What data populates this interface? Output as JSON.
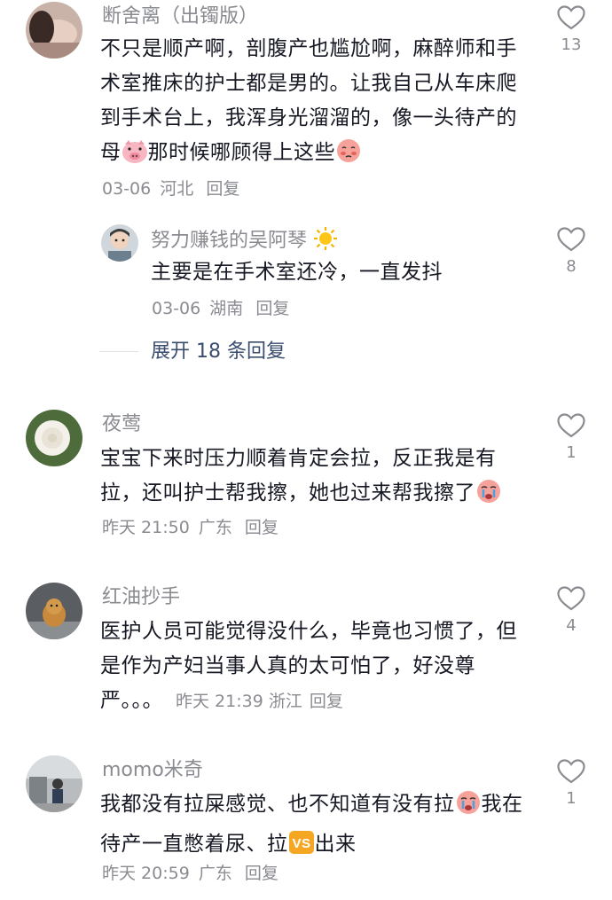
{
  "comments": [
    {
      "username": "断舍离（出镯版）",
      "text": "不只是顺产啊，剖腹产也尴尬啊，麻醉师和手术室推床的护士都是男的。让我自己从车床爬到手术台上，我浑身光溜溜的，像一头待产的母",
      "text_after_pig": "那时候哪顾得上这些",
      "date": "03-06",
      "location": "河北",
      "reply_label": "回复",
      "likes": "13",
      "reply": {
        "username": "努力赚钱的吴阿琴",
        "text": "主要是在手术室还冷，一直发抖",
        "date": "03-06",
        "location": "湖南",
        "reply_label": "回复",
        "likes": "8"
      },
      "expand_label": "展开 18 条回复"
    },
    {
      "username": "夜莺",
      "text": "宝宝下来时压力顺着肯定会拉，反正我是有拉，还叫护士帮我擦，她也过来帮我擦了",
      "date": "昨天 21:50",
      "location": "广东",
      "reply_label": "回复",
      "likes": "1"
    },
    {
      "username": "红油抄手",
      "text": "医护人员可能觉得没什么，毕竟也习惯了，但是作为产妇当事人真的太可怕了，好没尊严。。。",
      "date": "昨天 21:39",
      "location": "浙江",
      "reply_label": "回复",
      "likes": "4"
    },
    {
      "username": "momo米奇",
      "text_part1": "我都没有拉屎感觉、也不知道有没有拉",
      "text_part2": "我在待产一直憋着尿、拉",
      "text_part3": "出来",
      "vs_label": "VS",
      "date": "昨天 20:59",
      "location": "广东",
      "reply_label": "回复",
      "likes": "1"
    }
  ],
  "icons": {
    "like": "heart-outline-icon",
    "pig": "pig-face-emoji",
    "sun": "sun-emoji",
    "blush": "blushing-face-emoji",
    "cry": "crying-face-emoji",
    "vs": "vs-badge"
  },
  "colors": {
    "text": "#161823",
    "muted": "#8a8b91",
    "link": "#3a4d6e",
    "vs_badge": "#f5a623"
  }
}
